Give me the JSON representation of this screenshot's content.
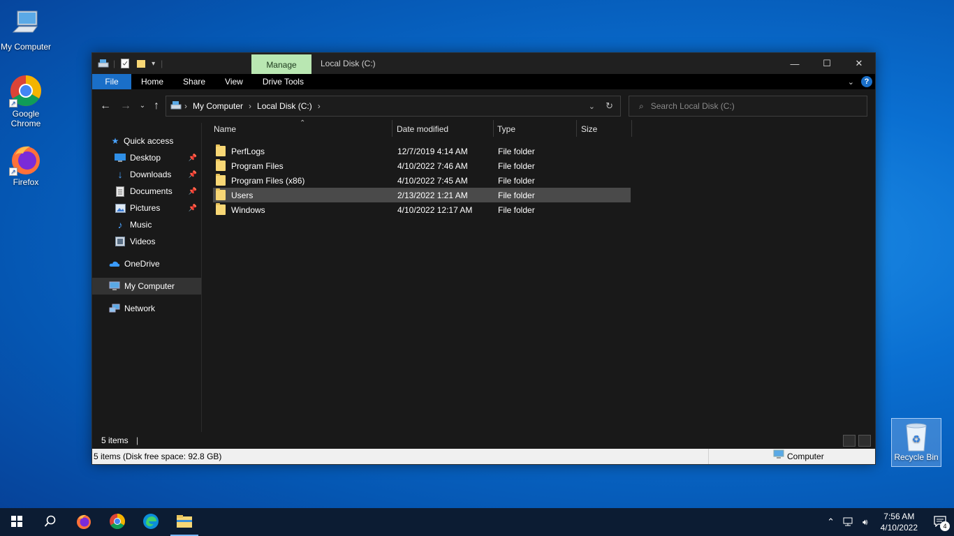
{
  "desktop": {
    "icons": [
      {
        "label": "My Computer",
        "icon": "computer-icon"
      },
      {
        "label": "Google Chrome",
        "icon": "chrome-icon"
      },
      {
        "label": "Firefox",
        "icon": "firefox-icon"
      }
    ],
    "recycle_bin": "Recycle Bin"
  },
  "window": {
    "manage_tab": "Manage",
    "title": "Local Disk (C:)",
    "ribbon_tabs": [
      "File",
      "Home",
      "Share",
      "View",
      "Drive Tools"
    ],
    "breadcrumb": [
      "My Computer",
      "Local Disk (C:)"
    ],
    "search_placeholder": "Search Local Disk (C:)",
    "nav": {
      "quick_access": "Quick access",
      "pinned": [
        "Desktop",
        "Downloads",
        "Documents",
        "Pictures"
      ],
      "unpinned": [
        "Music",
        "Videos"
      ],
      "onedrive": "OneDrive",
      "my_computer": "My Computer",
      "network": "Network"
    },
    "columns": {
      "name": "Name",
      "date": "Date modified",
      "type": "Type",
      "size": "Size"
    },
    "rows": [
      {
        "name": "PerfLogs",
        "date": "12/7/2019 4:14 AM",
        "type": "File folder",
        "size": ""
      },
      {
        "name": "Program Files",
        "date": "4/10/2022 7:46 AM",
        "type": "File folder",
        "size": ""
      },
      {
        "name": "Program Files (x86)",
        "date": "4/10/2022 7:45 AM",
        "type": "File folder",
        "size": ""
      },
      {
        "name": "Users",
        "date": "2/13/2022 1:21 AM",
        "type": "File folder",
        "size": "",
        "selected": true
      },
      {
        "name": "Windows",
        "date": "4/10/2022 12:17 AM",
        "type": "File folder",
        "size": ""
      }
    ],
    "status": "5 items",
    "details": "5 items (Disk free space: 92.8 GB)",
    "details_location": "Computer"
  },
  "taskbar": {
    "time": "7:56 AM",
    "date": "4/10/2022",
    "notification_count": "4"
  },
  "colors": {
    "accent": "#1a6fc8",
    "manage_tab": "#b9e7b2",
    "folder": "#f8d775"
  }
}
